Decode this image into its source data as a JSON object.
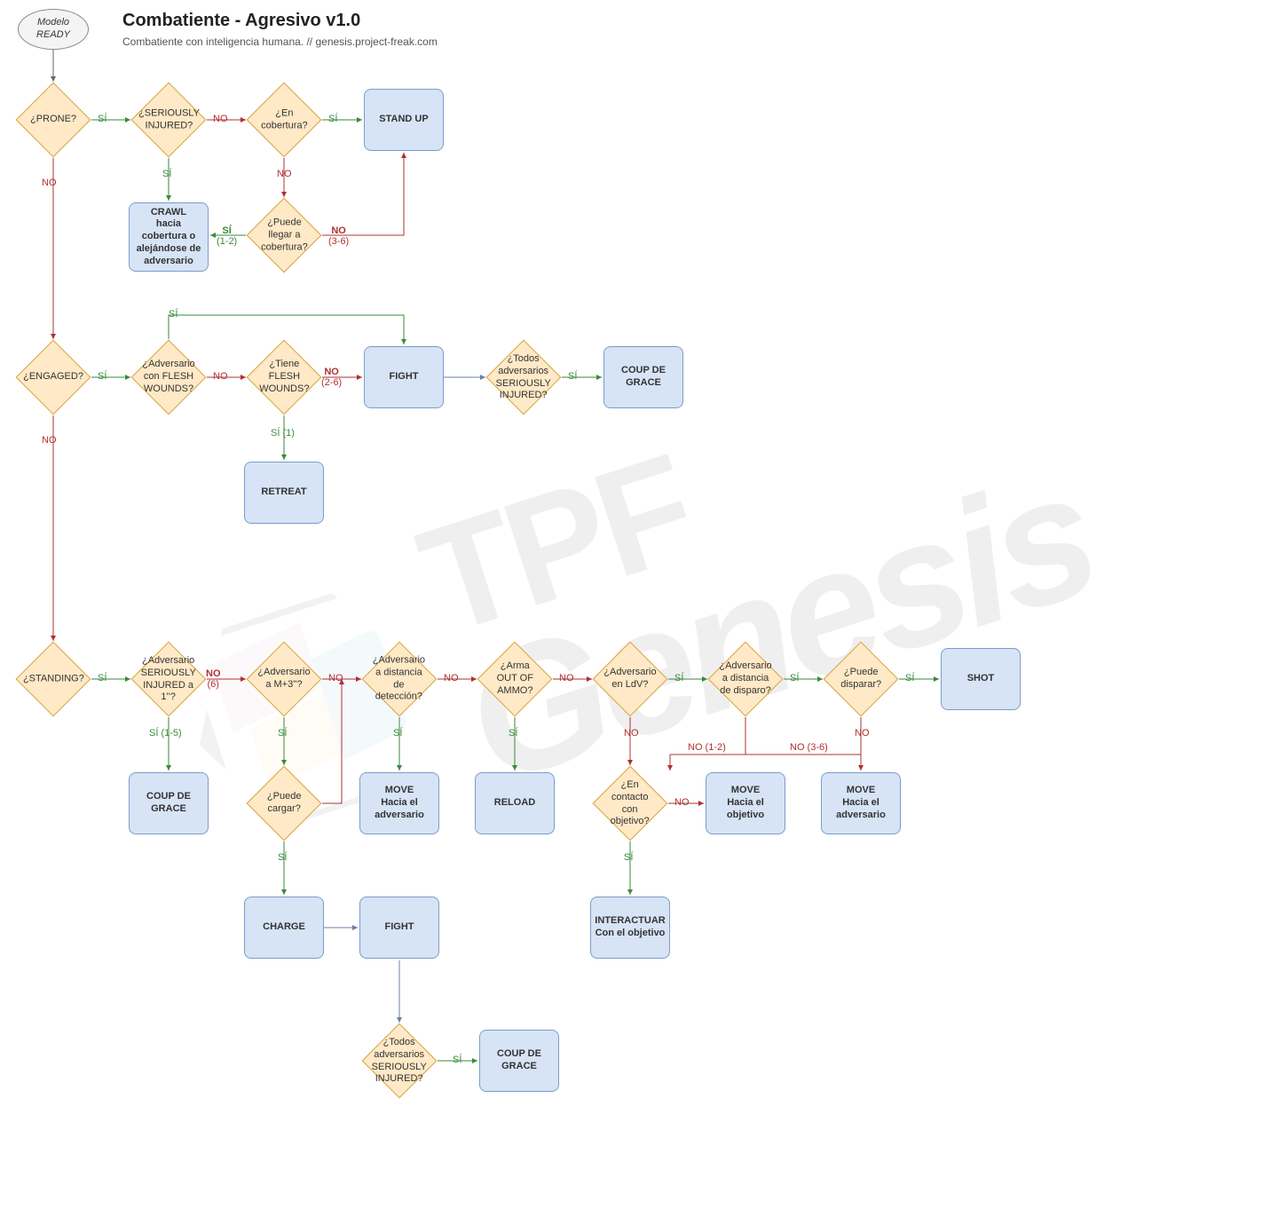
{
  "header": {
    "title": "Combatiente - Agresivo v1.0",
    "subtitle": "Combatiente con inteligencia humana. // genesis.project-freak.com"
  },
  "watermark": {
    "line1": "TPF",
    "line2": "Genesis"
  },
  "labels": {
    "si": "SÍ",
    "no": "NO",
    "si_1_2": "SÍ\n(1-2)",
    "no_3_6": "NO\n(3-6)",
    "no_2_6": "NO\n(2-6)",
    "si_1": "SÍ (1)",
    "si_1_5": "SÍ (1-5)",
    "no_6": "NO\n(6)",
    "no_1_2": "NO (1-2)",
    "no_3_6b": "NO (3-6)"
  },
  "nodes": {
    "start": "Modelo READY",
    "prone": "¿PRONE?",
    "ser_inj": "¿SERIOUSLY INJURED?",
    "en_cob": "¿En cobertura?",
    "standup": "STAND UP",
    "crawl": "CRAWL\nhacia cobertura o alejándose de adversario",
    "llega_cob": "¿Puede llegar a cobertura?",
    "engaged": "¿ENGAGED?",
    "adv_fw": "¿Adversario con FLESH WOUNDS?",
    "tiene_fw": "¿Tiene FLESH WOUNDS?",
    "fight1": "FIGHT",
    "todos_si1": "¿Todos adversarios SERIOUSLY INJURED?",
    "cdg1": "COUP DE GRACE",
    "retreat": "RETREAT",
    "standing": "¿STANDING?",
    "adv_si_1": "¿Adversario SERIOUSLY INJURED a 1''?",
    "cdg2": "COUP DE GRACE",
    "adv_m3": "¿Adversario a M+3''?",
    "puede_cargar": "¿Puede cargar?",
    "charge": "CHARGE",
    "fight2": "FIGHT",
    "todos_si2": "¿Todos adversarios SERIOUSLY INJURED?",
    "cdg3": "COUP DE GRACE",
    "adv_detec": "¿Adversario a distancia de detección?",
    "move_adv1": "MOVE\nHacia el adversario",
    "out_ammo": "¿Arma OUT OF AMMO?",
    "reload": "RELOAD",
    "adv_ldv": "¿Adversario en LdV?",
    "contacto_obj": "¿En contacto con objetivo?",
    "interactuar": "INTERACTUAR\nCon el objetivo",
    "move_obj": "MOVE\nHacia el objetivo",
    "adv_disp_dist": "¿Adversario a distancia de disparo?",
    "move_adv2": "MOVE\nHacia el adversario",
    "puede_disp": "¿Puede disparar?",
    "shot": "SHOT"
  }
}
